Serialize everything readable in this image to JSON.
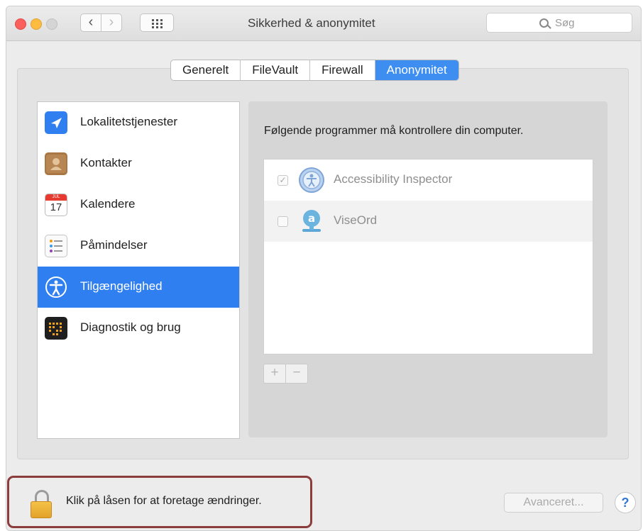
{
  "window": {
    "title": "Sikkerhed & anonymitet"
  },
  "toolbar": {
    "back_symbol": "‹",
    "forward_symbol": "›",
    "search_placeholder": "Søg"
  },
  "tabs": [
    {
      "label": "Generelt",
      "active": false
    },
    {
      "label": "FileVault",
      "active": false
    },
    {
      "label": "Firewall",
      "active": false
    },
    {
      "label": "Anonymitet",
      "active": true
    }
  ],
  "sidebar": {
    "items": [
      {
        "label": "Lokalitetstjenester",
        "icon": "location-arrow-icon",
        "selected": false
      },
      {
        "label": "Kontakter",
        "icon": "contacts-book-icon",
        "selected": false
      },
      {
        "label": "Kalendere",
        "icon": "calendar-icon",
        "selected": false,
        "icon_text": "17",
        "icon_month": "JUL"
      },
      {
        "label": "Påmindelser",
        "icon": "reminders-list-icon",
        "selected": false
      },
      {
        "label": "Tilgængelighed",
        "icon": "accessibility-icon",
        "selected": true
      },
      {
        "label": "Diagnostik og brug",
        "icon": "diagnostics-grid-icon",
        "selected": false
      }
    ]
  },
  "main": {
    "description": "Følgende programmer må kontrollere din computer.",
    "apps": [
      {
        "name": "Accessibility Inspector",
        "checked": true,
        "icon": "accessibility-inspector-icon"
      },
      {
        "name": "ViseOrd",
        "checked": false,
        "icon": "viseord-icon"
      }
    ],
    "add_label": "+",
    "remove_label": "−"
  },
  "footer": {
    "lock_text": "Klik på låsen for at foretage ændringer.",
    "advanced_label": "Avanceret...",
    "help_label": "?"
  },
  "colors": {
    "accent": "#2f7ff0",
    "tab_active": "#3d8ef0",
    "lock_highlight": "#8a3d3a"
  }
}
